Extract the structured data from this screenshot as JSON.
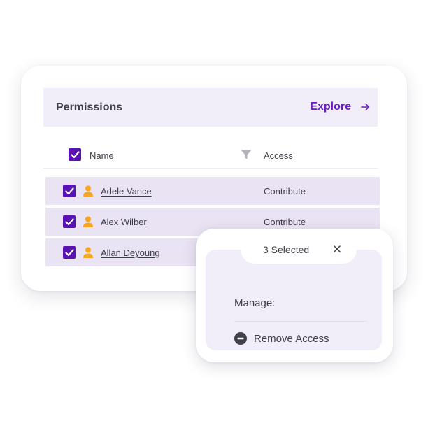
{
  "permissions": {
    "title": "Permissions",
    "explore_label": "Explore",
    "explore_icon": "arrow-right-icon"
  },
  "columns": {
    "name": "Name",
    "access": "Access",
    "filter_icon": "filter-icon"
  },
  "rows": [
    {
      "name": "Adele Vance",
      "access": "Contribute",
      "checked": true,
      "icon": "user-icon"
    },
    {
      "name": "Alex Wilber",
      "access": "Contribute",
      "checked": true,
      "icon": "user-icon"
    },
    {
      "name": "Allan Deyoung",
      "access": "",
      "checked": true,
      "icon": "user-icon"
    }
  ],
  "popup": {
    "selected_label": "3 Selected",
    "close_icon": "close-icon",
    "manage_label": "Manage:",
    "remove_label": "Remove Access",
    "remove_icon": "minus-circle-icon"
  },
  "colors": {
    "accent": "#6a1fc8",
    "checkbox": "#5b12b3",
    "header_bg": "#f1edf9",
    "row_bg": "#e9e3f3",
    "user_icon": "#f5a623",
    "text": "#3f3f48"
  }
}
